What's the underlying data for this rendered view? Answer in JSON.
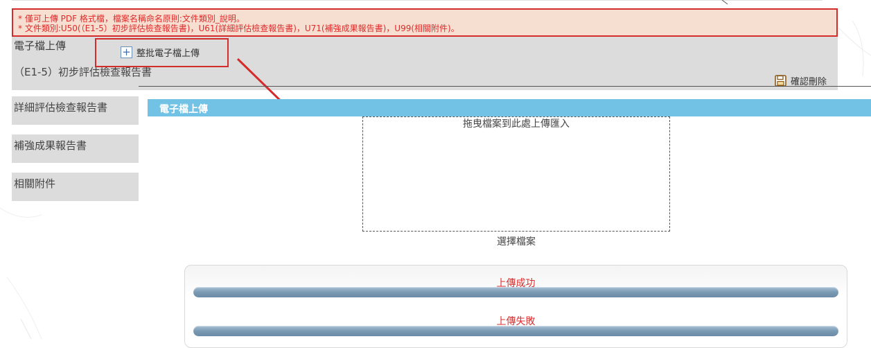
{
  "notice": {
    "line1": "* 僅可上傳 PDF 格式檔，檔案名稱命名原則:文件類別_說明。",
    "line2": "* 文件類別:U50(（E1-5）初步評估檢查報告書)，U61(詳細評估檢查報告書)，U71(補強成果報告書)，U99(相關附件)。"
  },
  "upload": {
    "title": "電子檔上傳",
    "current_doc": "（E1-5）初步評估檢查報告書",
    "batch_upload_label": "整批電子檔上傳",
    "confirm_delete_label": "確認刪除"
  },
  "sidebar": {
    "items": [
      {
        "label": "詳細評估檢查報告書"
      },
      {
        "label": "補強成果報告書"
      },
      {
        "label": "相關附件"
      }
    ]
  },
  "dialog": {
    "title": "電子檔上傳",
    "drop_text": "拖曳檔案到此處上傳匯入",
    "choose_file": "選擇檔案",
    "success_label": "上傳成功",
    "fail_label": "上傳失敗"
  },
  "colors": {
    "notice_bg": "#f6dfd1",
    "alert_red": "#d42b2b",
    "header_blue": "#72c2e6",
    "panel_gray": "#dcdcdc"
  }
}
